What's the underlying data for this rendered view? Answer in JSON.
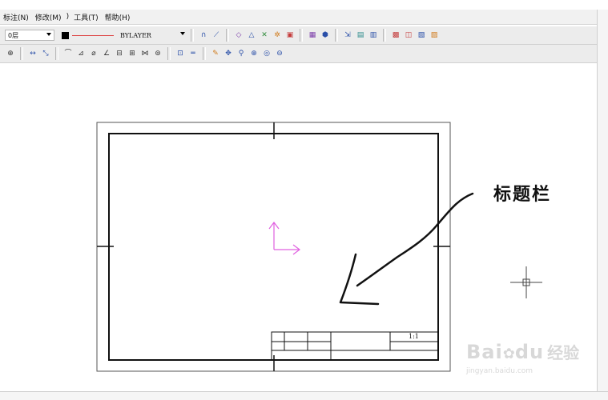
{
  "menubar": {
    "items": [
      "标注(N)",
      "修改(M)",
      ")",
      "工具(T)",
      "帮助(H)"
    ]
  },
  "toolbar1": {
    "layer_value": "0层",
    "linetype_value": "BYLAYER",
    "icons": [
      "routing-icon",
      "polyline-icon",
      "area-icon",
      "measure-icon",
      "triangle-icon",
      "explode-icon",
      "text-edit-icon",
      "block-icon",
      "3d-box-icon",
      "insert-icon",
      "table-icon",
      "attribute-icon",
      "layer-state-icon",
      "layer-icon",
      "properties-icon",
      "grid-icon"
    ]
  },
  "toolbar2": {
    "icons": [
      "align-icon",
      "dimension-linear-icon",
      "dimension-aligned-icon",
      "dimension-arc-icon",
      "dimension-radius-icon",
      "dimension-diameter-icon",
      "dimension-angle-icon",
      "dimension-baseline-icon",
      "dimension-continue-icon",
      "dimension-tolerance-icon",
      "dimension-center-icon",
      "zoom-window-icon",
      "zoom-prev-icon",
      "pencil-icon",
      "pan-icon",
      "zoom-realtime-icon",
      "zoom-extents-icon",
      "zoom-all-icon",
      "zoom-out-icon"
    ]
  },
  "drawing": {
    "annotation_label": "标题栏",
    "title_cell_text": "1:1"
  },
  "watermark": {
    "brand": "Bai",
    "brand_tail": "du",
    "cn": "经验",
    "url": "jingyan.baidu.com"
  },
  "colors": {
    "ucs_axis": "#e060e0",
    "frame": "#111111",
    "annotation": "#111111"
  }
}
